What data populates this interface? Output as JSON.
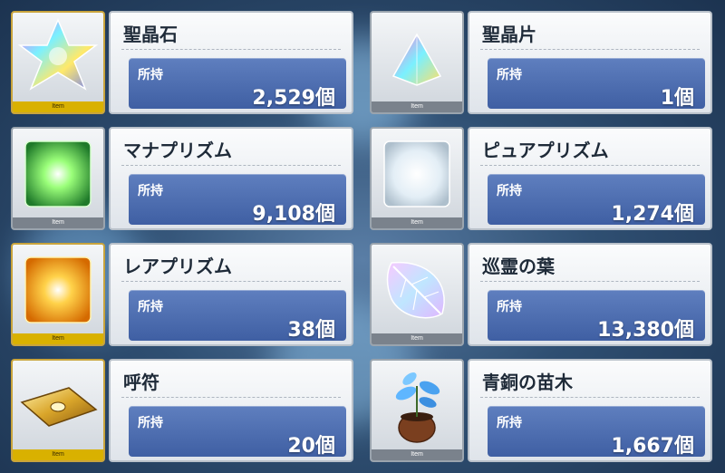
{
  "items": [
    {
      "name": "聖晶石",
      "owned_label": "所持",
      "count": "2,529個",
      "tag": "Item"
    },
    {
      "name": "聖晶片",
      "owned_label": "所持",
      "count": "1個",
      "tag": "Item"
    },
    {
      "name": "マナプリズム",
      "owned_label": "所持",
      "count": "9,108個",
      "tag": "Item"
    },
    {
      "name": "ピュアプリズム",
      "owned_label": "所持",
      "count": "1,274個",
      "tag": "Item"
    },
    {
      "name": "レアプリズム",
      "owned_label": "所持",
      "count": "38個",
      "tag": "Item"
    },
    {
      "name": "巡霊の葉",
      "owned_label": "所持",
      "count": "13,380個",
      "tag": "Item"
    },
    {
      "name": "呼符",
      "owned_label": "所持",
      "count": "20個",
      "tag": "Item"
    },
    {
      "name": "青銅の苗木",
      "owned_label": "所持",
      "count": "1,667個",
      "tag": "Item"
    }
  ],
  "icons": [
    "saint-quartz-icon",
    "quartz-fragment-icon",
    "mana-prism-icon",
    "pure-prism-icon",
    "rare-prism-icon",
    "leaf-icon",
    "summon-ticket-icon",
    "bronze-sapling-icon"
  ]
}
